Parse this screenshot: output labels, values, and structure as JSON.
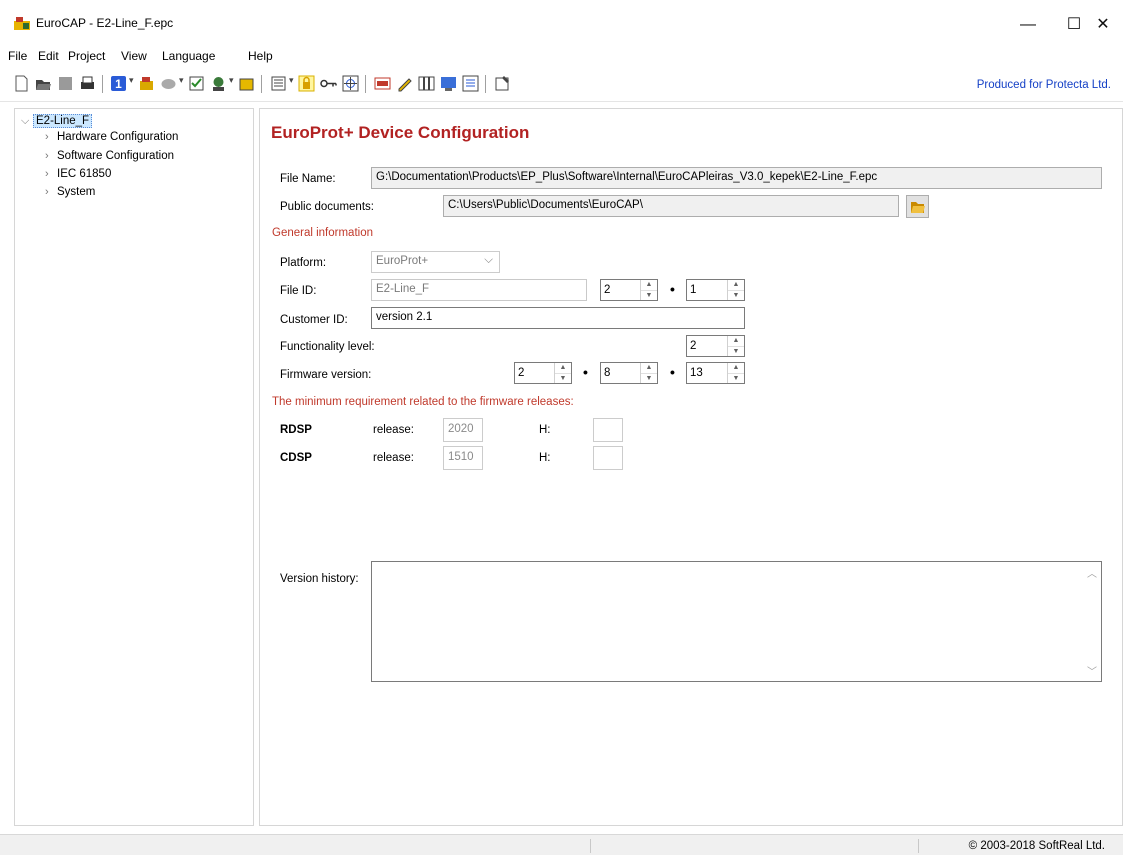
{
  "window": {
    "title": "EuroCAP - E2-Line_F.epc",
    "minimize": "—",
    "maximize": "☐",
    "close": "✕"
  },
  "menu": [
    "File",
    "Edit",
    "Project",
    "View",
    "Language",
    "Help"
  ],
  "toolbar": {
    "produced": "Produced for Protecta Ltd.",
    "number_badge": "1",
    "icons": [
      "new-icon",
      "open-icon",
      "save-icon",
      "print-icon",
      "number-icon",
      "hardware-icon",
      "disk-icon",
      "checkbox-icon",
      "tool-icon",
      "export-icon",
      "config-icon",
      "lock-icon",
      "key-icon",
      "target-icon",
      "com-icon",
      "edit-icon",
      "columns-icon",
      "lcd-icon",
      "list-icon",
      "properties-icon"
    ]
  },
  "tree": {
    "root": "E2-Line_F",
    "children": [
      "Hardware Configuration",
      "Software Configuration",
      "IEC 61850",
      "System"
    ]
  },
  "main": {
    "title": "EuroProt+ Device Configuration",
    "file_name_label": "File Name:",
    "file_name": "G:\\Documentation\\Products\\EP_Plus\\Software\\Internal\\EuroCAPleiras_V3.0_kepek\\E2-Line_F.epc",
    "public_docs_label": "Public documents:",
    "public_docs": "C:\\Users\\Public\\Documents\\EuroCAP\\",
    "general_info": "General information",
    "platform_label": "Platform:",
    "platform": "EuroProt+",
    "file_id_label": "File ID:",
    "file_id": "E2-Line_F",
    "file_id_major": "2",
    "file_id_minor": "1",
    "customer_id_label": "Customer ID:",
    "customer_id": "version 2.1",
    "functionality_label": "Functionality level:",
    "functionality": "2",
    "firmware_label": "Firmware version:",
    "firmware": [
      "2",
      "8",
      "13"
    ],
    "min_req": "The minimum requirement related to the firmware releases:",
    "rdsp": {
      "name": "RDSP",
      "release_label": "release:",
      "release": "2020",
      "h_label": "H:",
      "h": ""
    },
    "cdsp": {
      "name": "CDSP",
      "release_label": "release:",
      "release": "1510",
      "h_label": "H:",
      "h": ""
    },
    "version_history_label": "Version history:",
    "version_history": ""
  },
  "status": {
    "copyright": "© 2003-2018 SoftReal Ltd."
  }
}
